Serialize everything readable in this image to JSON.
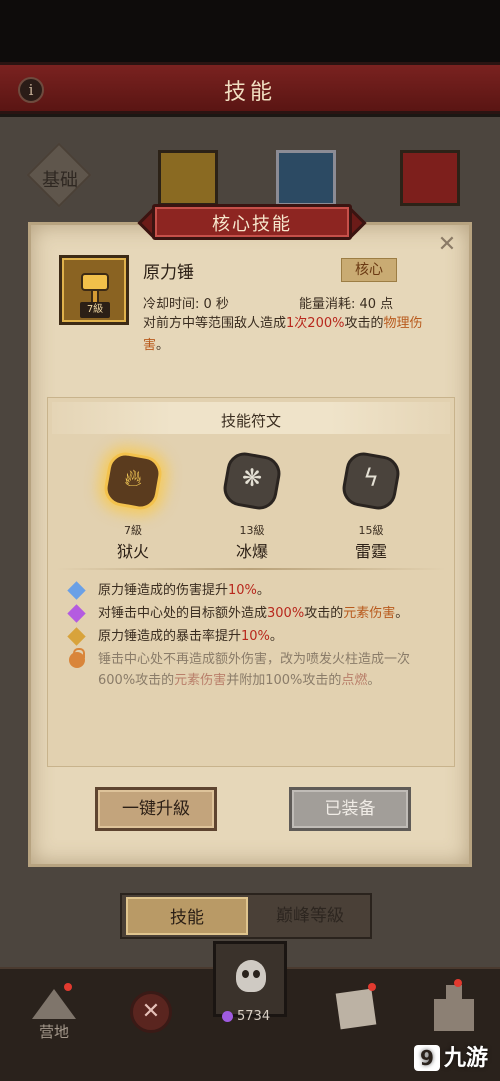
{
  "header": {
    "title": "技能",
    "info_icon": "info-icon"
  },
  "background_tabs": {
    "basic_label": "基础"
  },
  "dialog": {
    "banner": "核心技能",
    "close_icon": "close-icon",
    "skill": {
      "name": "原力锤",
      "level_badge": "7級",
      "tag": "核心",
      "cooldown": "冷却时间: 0 秒",
      "energy": "能量消耗: 40 点",
      "desc_parts": [
        "对前方中等范围敌人造成",
        "1次",
        "200%",
        "攻击的",
        "物理伤害",
        "。"
      ]
    },
    "runes": {
      "title": "技能符文",
      "items": [
        {
          "level": "7級",
          "name": "狱火",
          "glyph": "fire-icon",
          "active": true
        },
        {
          "level": "13級",
          "name": "冰爆",
          "glyph": "ice-burst-icon",
          "active": false
        },
        {
          "level": "15級",
          "name": "雷霆",
          "glyph": "thunder-icon",
          "active": false
        }
      ]
    },
    "effects": [
      {
        "parts": [
          "原力锤造成的伤害提升",
          "10%",
          "。"
        ],
        "icon": "blue-diamond"
      },
      {
        "parts": [
          "对锤击中心处的目标额外造成",
          "300%",
          "攻击的",
          "元素伤害",
          "。"
        ],
        "icon": "purple-diamond"
      },
      {
        "parts": [
          "原力锤造成的暴击率提升",
          "10%",
          "。"
        ],
        "icon": "gold-diamond"
      },
      {
        "parts": [
          "锤击中心处不再造成额外伤害，改为喷发火柱造成一次600%攻击的",
          "元素伤害",
          "并附加100%攻击的",
          "点燃",
          "。"
        ],
        "icon": "lock-icon",
        "locked": true
      }
    ],
    "buttons": {
      "upgrade": "一键升級",
      "equipped": "已装备"
    }
  },
  "bottom_tabs": {
    "skill": "技能",
    "peak": "巅峰等級"
  },
  "bottom_nav": {
    "camp_label": "营地",
    "currency_value": "5734"
  },
  "watermark": {
    "logo": "九游"
  }
}
